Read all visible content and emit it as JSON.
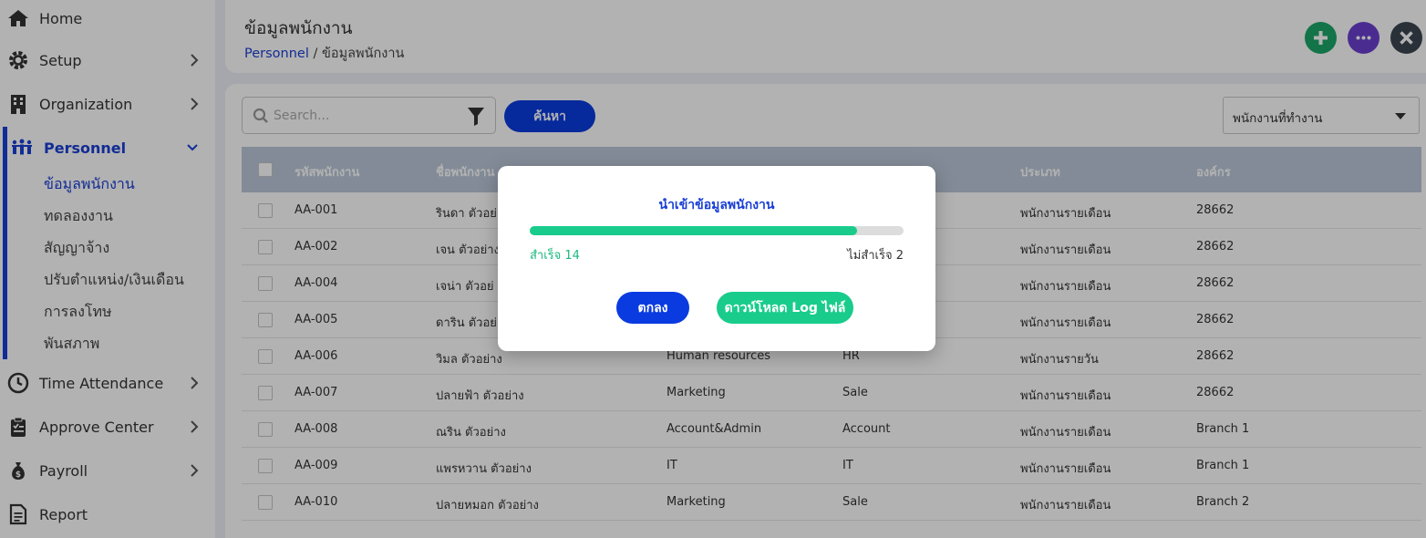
{
  "sidebar": {
    "items": [
      {
        "label": "Home",
        "icon": "home-icon"
      },
      {
        "label": "Setup",
        "icon": "gear-icon"
      },
      {
        "label": "Organization",
        "icon": "building-icon"
      },
      {
        "label": "Personnel",
        "icon": "people-icon"
      },
      {
        "label": "Time Attendance",
        "icon": "clock-icon"
      },
      {
        "label": "Approve Center",
        "icon": "clipboard-icon"
      },
      {
        "label": "Payroll",
        "icon": "money-bag-icon"
      },
      {
        "label": "Report",
        "icon": "document-icon"
      }
    ],
    "sub_items": [
      "ข้อมูลพนักงาน",
      "ทดลองงาน",
      "สัญญาจ้าง",
      "ปรับตำแหน่ง/เงินเดือน",
      "การลงโทษ",
      "พันสภาพ"
    ]
  },
  "header": {
    "title": "ข้อมูลพนักงาน",
    "breadcrumb_link": "Personnel",
    "breadcrumb_sep": " / ",
    "breadcrumb_current": "ข้อมูลพนักงาน"
  },
  "toolbar": {
    "search_placeholder": "Search...",
    "search_button": "ค้นหา",
    "status_select": "พนักงานที่ทำงาน"
  },
  "table": {
    "headers": [
      "รหัสพนักงาน",
      "ชื่อพนักงาน",
      "",
      "",
      "ประเภท",
      "องค์กร"
    ],
    "rows": [
      [
        "AA-001",
        "รินดา ตัวอย่",
        "",
        "",
        "พนักงานรายเดือน",
        "28662"
      ],
      [
        "AA-002",
        "เจน ตัวอย่าง",
        "",
        "",
        "พนักงานรายเดือน",
        "28662"
      ],
      [
        "AA-004",
        "เจน่า ตัวอย่",
        "",
        "",
        "พนักงานรายเดือน",
        "28662"
      ],
      [
        "AA-005",
        "ดาริน ตัวอย่",
        "",
        "",
        "พนักงานรายเดือน",
        "28662"
      ],
      [
        "AA-006",
        "วิมล ตัวอย่าง",
        "Human resources",
        "HR",
        "พนักงานรายวัน",
        "28662"
      ],
      [
        "AA-007",
        "ปลายฟ้า ตัวอย่าง",
        "Marketing",
        "Sale",
        "พนักงานรายเดือน",
        "28662"
      ],
      [
        "AA-008",
        "ณริน ตัวอย่าง",
        "Account&Admin",
        "Account",
        "พนักงานรายเดือน",
        "Branch 1"
      ],
      [
        "AA-009",
        "แพรหวาน ตัวอย่าง",
        "IT",
        "IT",
        "พนักงานรายเดือน",
        "Branch 1"
      ],
      [
        "AA-010",
        "ปลายหมอก ตัวอย่าง",
        "Marketing",
        "Sale",
        "พนักงานรายเดือน",
        "Branch 2"
      ]
    ]
  },
  "modal": {
    "title": "นำเข้าข้อมูลพนักงาน",
    "progress_fraction": 0.875,
    "success_label": "สำเร็จ 14",
    "fail_label": "ไม่สำเร็จ 2",
    "ok_button": "ตกลง",
    "download_button": "ดาวน์โหลด Log ไฟล์"
  },
  "colors": {
    "accent_blue": "#0a3be0",
    "success_green": "#19cc8c",
    "add_button": "#1aa668",
    "more_button": "#6a3fd0",
    "close_button": "#3c4550"
  }
}
